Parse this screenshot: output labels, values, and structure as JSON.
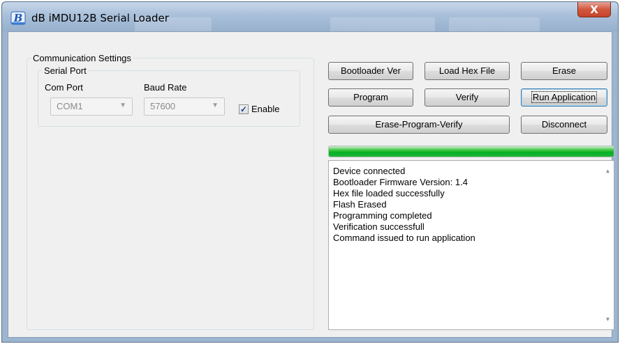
{
  "window": {
    "title": "dB iMDU12B Serial Loader",
    "close_glyph": "X",
    "icon": "bold-b-app-icon"
  },
  "comm": {
    "legend": "Communication Settings",
    "serial_legend": "Serial Port",
    "com_port_label": "Com Port",
    "baud_rate_label": "Baud Rate",
    "com_port_value": "COM1",
    "baud_rate_value": "57600",
    "enable_label": "Enable",
    "enable_checked": true
  },
  "buttons": {
    "bootloader_ver": "Bootloader Ver",
    "load_hex": "Load Hex File",
    "erase": "Erase",
    "program": "Program",
    "verify": "Verify",
    "run_app": "Run Application",
    "erase_program_verify": "Erase-Program-Verify",
    "disconnect": "Disconnect"
  },
  "progress": {
    "value_percent": 100,
    "color": "#06b025"
  },
  "log": {
    "lines": [
      "Device connected",
      "Bootloader Firmware Version: 1.4",
      "Hex file loaded successfully",
      "Flash Erased",
      "Programming completed",
      "Verification successfull",
      "Command issued to run application"
    ]
  }
}
